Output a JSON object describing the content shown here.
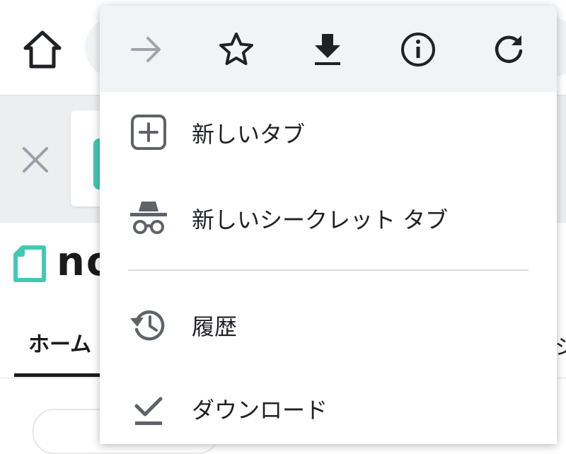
{
  "colors": {
    "icon_dark": "#202124",
    "icon_grey": "#5f6368",
    "icon_disabled": "#a0a4a8",
    "menu_bar_bg": "#f1f3f4",
    "note_accent": "#41c9b4"
  },
  "browser": {
    "home_icon": "home-icon",
    "tab_close_icon": "close-icon"
  },
  "page": {
    "logo_text": "no",
    "nav_home": "ホーム",
    "nav_right_fragment": "シ"
  },
  "menu": {
    "iconbar": [
      {
        "name": "forward-icon",
        "state": "disabled"
      },
      {
        "name": "star-icon",
        "state": "enabled"
      },
      {
        "name": "download-icon",
        "state": "enabled"
      },
      {
        "name": "info-icon",
        "state": "enabled"
      },
      {
        "name": "reload-icon",
        "state": "enabled"
      }
    ],
    "items": [
      {
        "icon": "new-tab-icon",
        "label": "新しいタブ"
      },
      {
        "icon": "incognito-icon",
        "label": "新しいシークレット タブ"
      },
      {
        "icon": "history-icon",
        "label": "履歴"
      },
      {
        "icon": "downloads-icon",
        "label": "ダウンロード"
      }
    ]
  }
}
